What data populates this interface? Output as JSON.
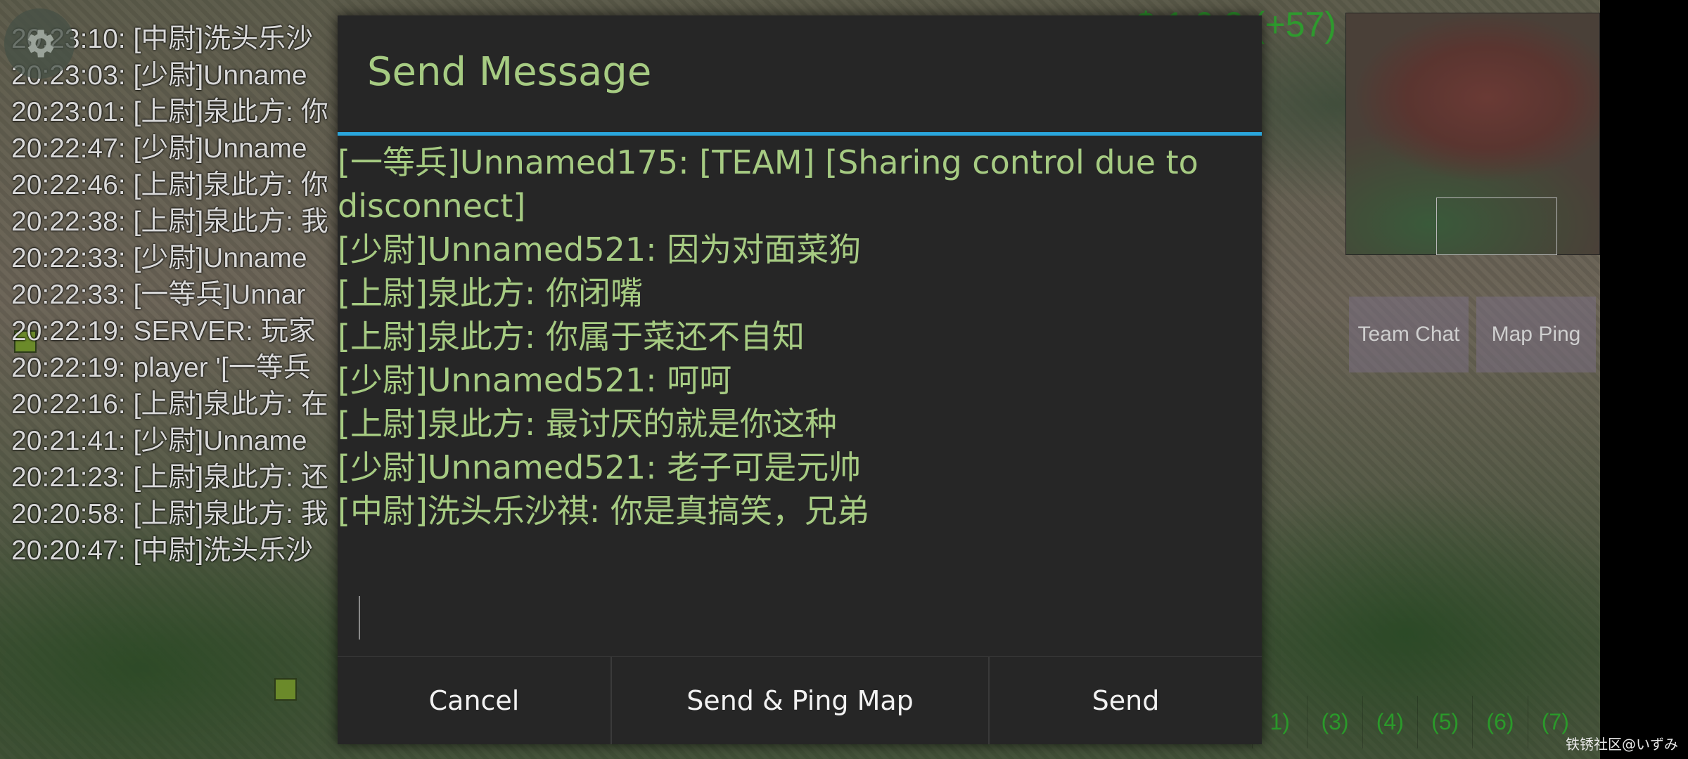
{
  "game": {
    "credits": "$ 1 0 2   (+57)",
    "chat_log": [
      "20:23:10: [中尉]洗头乐沙",
      "20:23:03: [少尉]Unname",
      "20:23:01: [上尉]泉此方: 你",
      "20:22:47: [少尉]Unname",
      "20:22:46: [上尉]泉此方: 你",
      "20:22:38: [上尉]泉此方: 我",
      "20:22:33: [少尉]Unname",
      "20:22:33: [一等兵]Unnar",
      "20:22:19: SERVER: 玩家",
      "20:22:19: player '[一等兵",
      "20:22:16: [上尉]泉此方: 在",
      "20:21:41: [少尉]Unname",
      "20:21:23: [上尉]泉此方: 还",
      "20:20:58: [上尉]泉此方: 我",
      "20:20:47: [中尉]洗头乐沙"
    ],
    "team_chat_label": "Team Chat",
    "map_ping_label": "Map Ping",
    "control_groups": [
      "1)",
      "(3)",
      "(4)",
      "(5)",
      "(6)",
      "(7)"
    ],
    "watermark": "铁锈社区@いずみ"
  },
  "dialog": {
    "title": "Send Message",
    "messages": [
      "[一等兵]Unnamed175: [TEAM] [Sharing control due to disconnect]",
      "[少尉]Unnamed521: 因为对面菜狗",
      "[上尉]泉此方: 你闭嘴",
      "[上尉]泉此方: 你属于菜还不自知",
      "[少尉]Unnamed521: 呵呵",
      "[上尉]泉此方: 最讨厌的就是你这种",
      "[少尉]Unnamed521: 老子可是元帅",
      "[中尉]洗头乐沙祺: 你是真搞笑，兄弟"
    ],
    "input_value": "",
    "buttons": {
      "cancel": "Cancel",
      "send_ping": "Send & Ping Map",
      "send": "Send"
    }
  },
  "colors": {
    "accent": "#2aa6dc",
    "dialog_text": "#a6cb82",
    "dialog_bg": "#262626",
    "credits": "#2e9a2e"
  },
  "icons": {
    "settings": "gear-icon"
  }
}
